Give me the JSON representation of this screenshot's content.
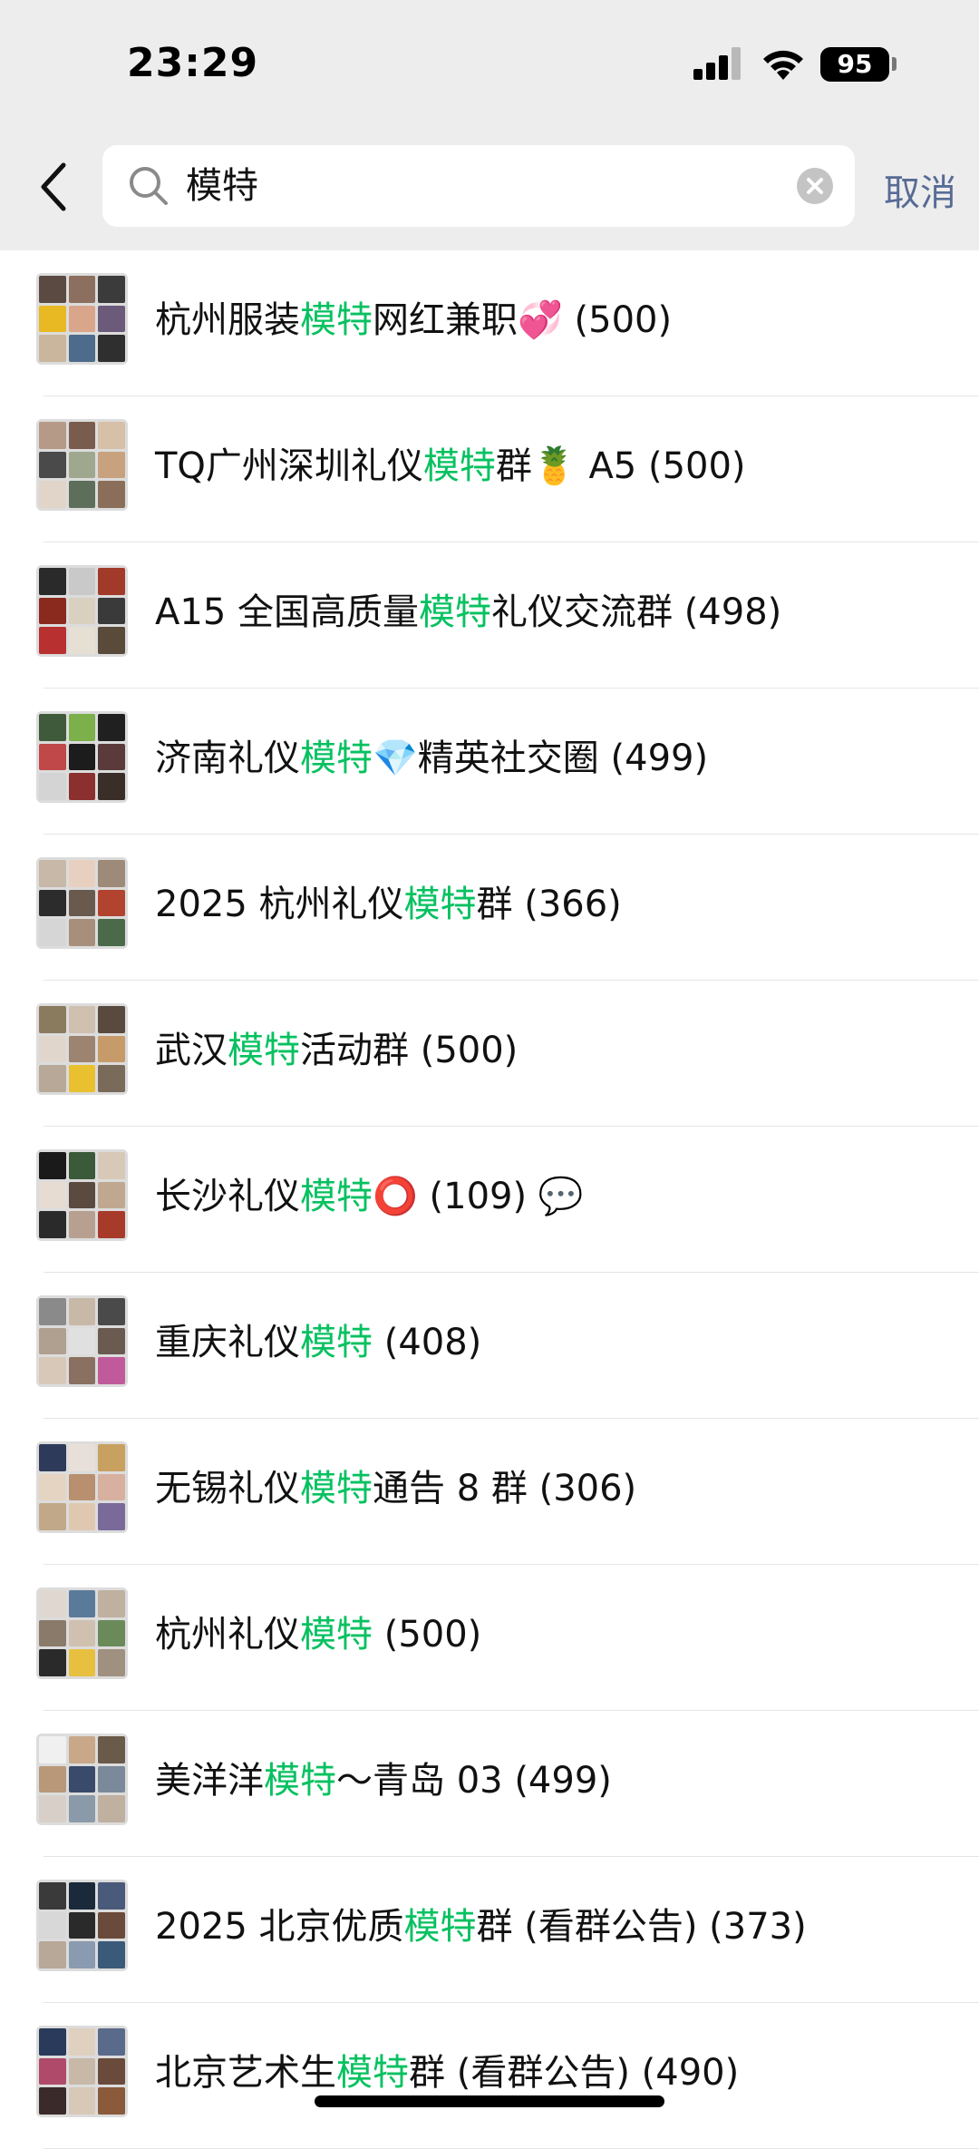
{
  "status_bar": {
    "time": "23:29",
    "battery": "95"
  },
  "search": {
    "query": "模特",
    "cancel_label": "取消"
  },
  "results": [
    {
      "pre": "杭州服装",
      "hl": "模特",
      "post": "网红兼职💞 (500)"
    },
    {
      "pre": "TQ广州深圳礼仪",
      "hl": "模特",
      "post": "群🍍 A5 (500)"
    },
    {
      "pre": "A15 全国高质量",
      "hl": "模特",
      "post": "礼仪交流群 (498)"
    },
    {
      "pre": "济南礼仪",
      "hl": "模特",
      "post": "💎精英社交圈 (499)"
    },
    {
      "pre": "2025 杭州礼仪",
      "hl": "模特",
      "post": "群 (366)"
    },
    {
      "pre": "武汉",
      "hl": "模特",
      "post": "活动群 (500)"
    },
    {
      "pre": "长沙礼仪",
      "hl": "模特",
      "post": "⭕ (109) 💬"
    },
    {
      "pre": "重庆礼仪",
      "hl": "模特",
      "post": " (408)"
    },
    {
      "pre": "无锡礼仪",
      "hl": "模特",
      "post": "通告 8 群 (306)"
    },
    {
      "pre": "杭州礼仪",
      "hl": "模特",
      "post": " (500)"
    },
    {
      "pre": "美洋洋",
      "hl": "模特",
      "post": "～青岛 03 (499)"
    },
    {
      "pre": "2025 北京优质",
      "hl": "模特",
      "post": "群 (看群公告) (373)"
    },
    {
      "pre": "北京艺术生",
      "hl": "模特",
      "post": "群 (看群公告) (490)"
    }
  ],
  "colors": {
    "highlight": "#07c160",
    "cancel": "#576b95",
    "header_bg": "#ededed"
  }
}
